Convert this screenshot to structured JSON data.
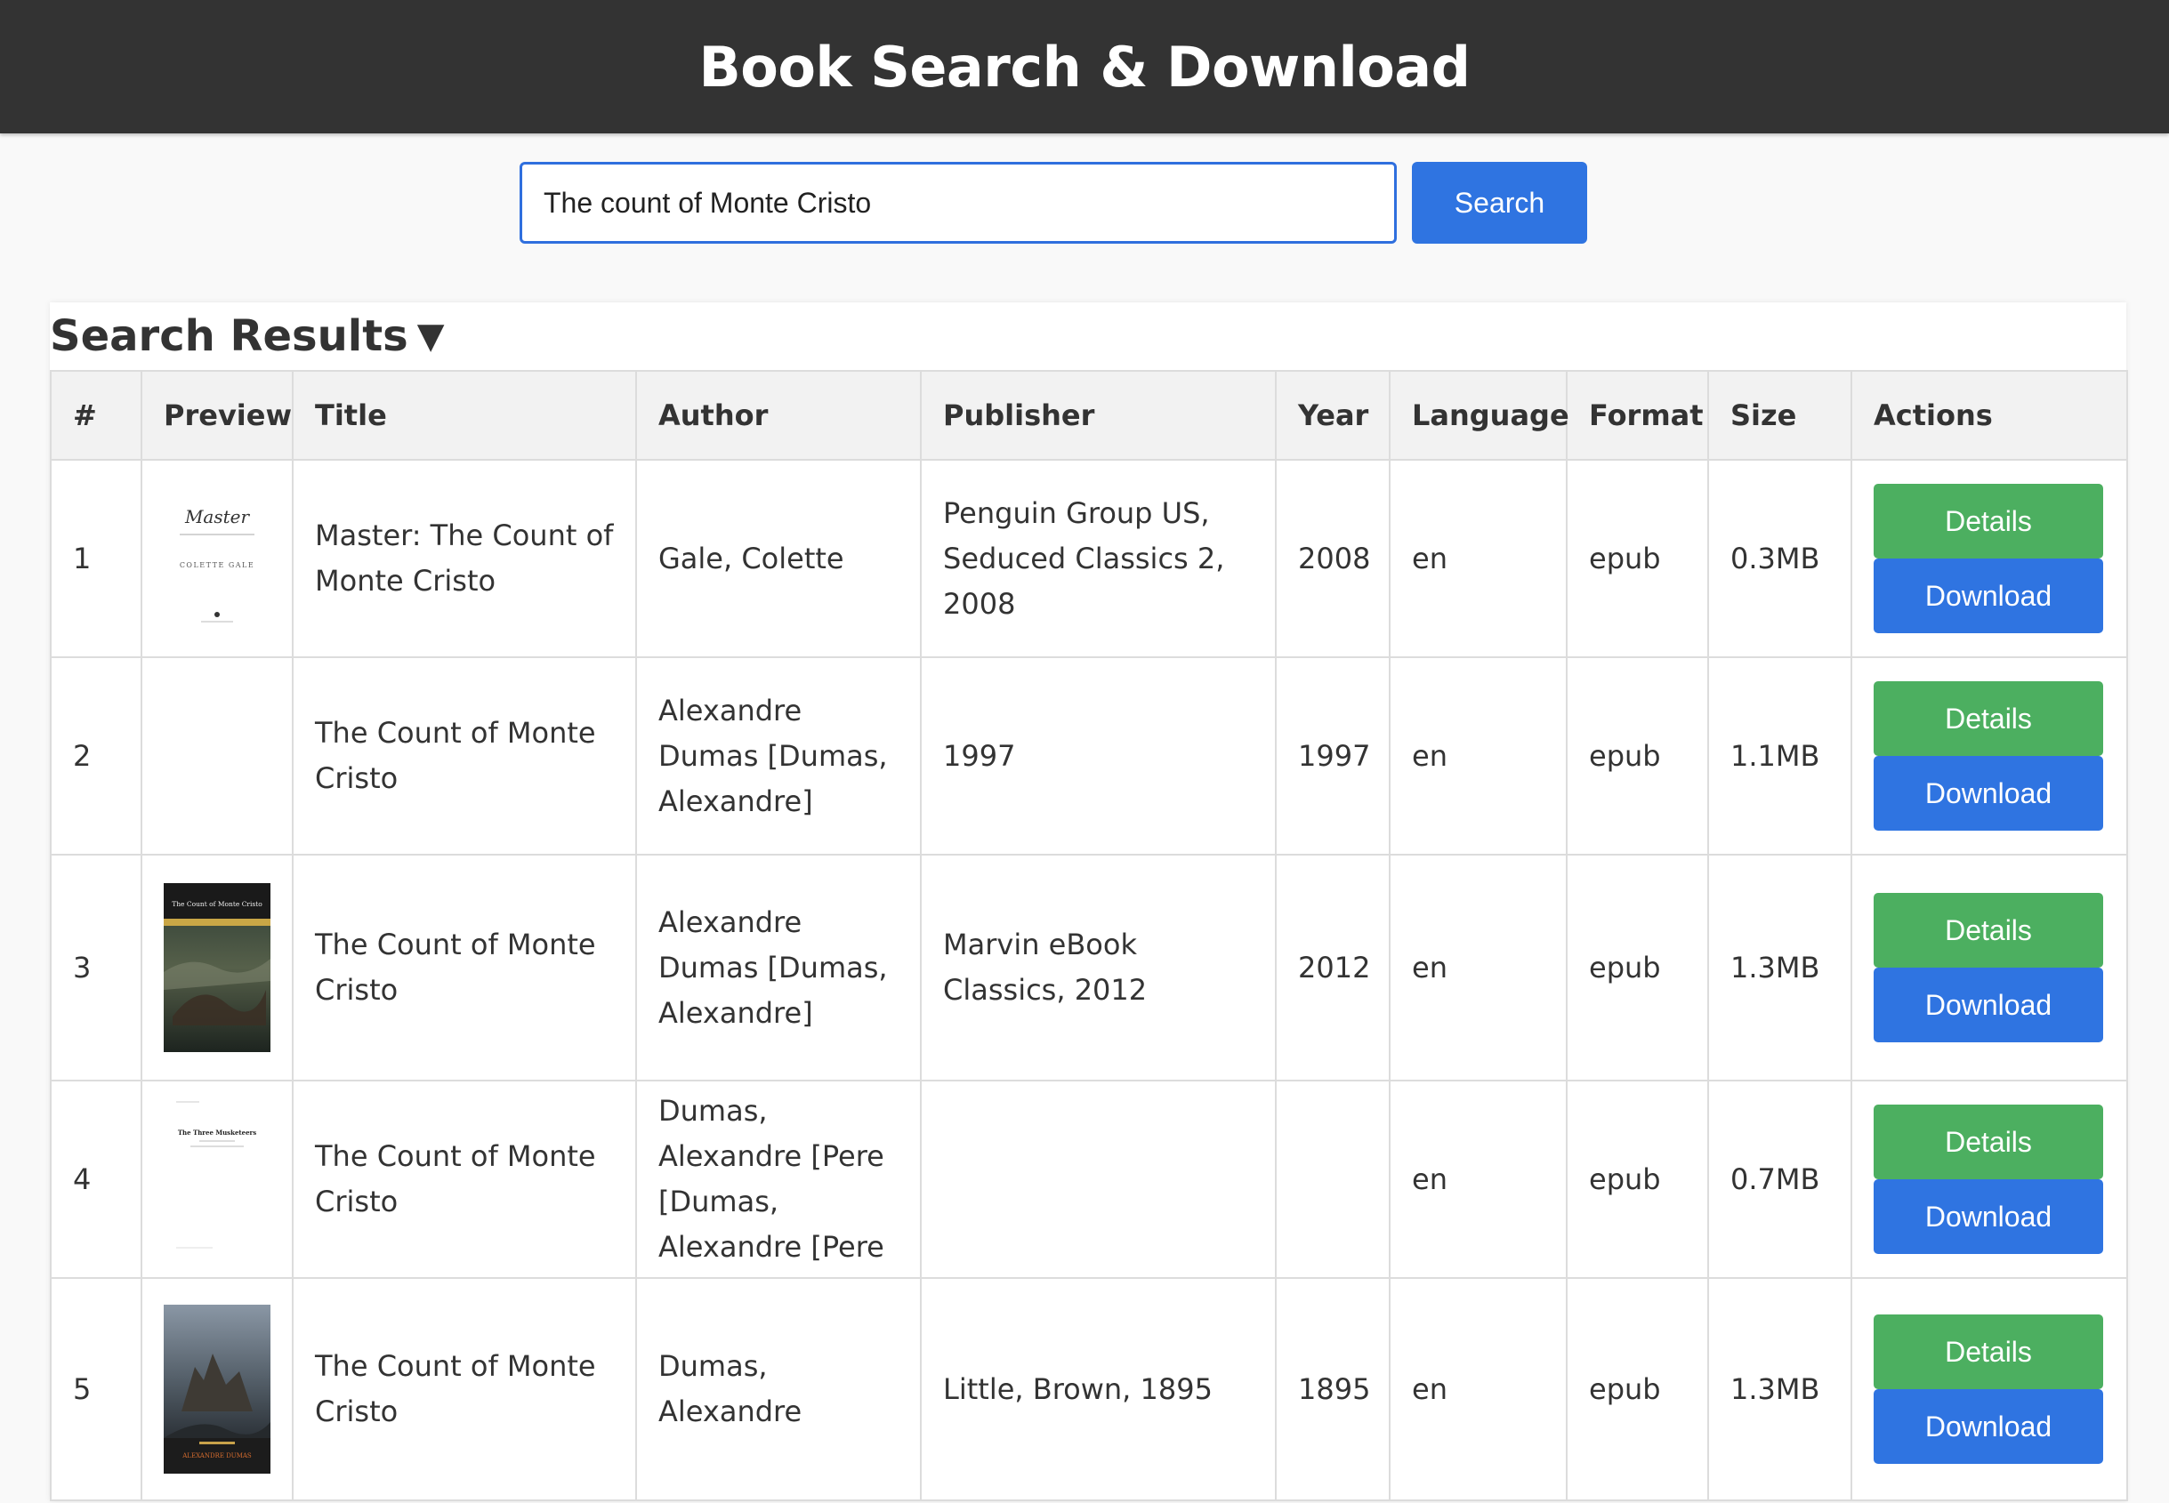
{
  "header": {
    "title": "Book Search & Download"
  },
  "search": {
    "value": "The count of Monte Cristo",
    "button_label": "Search"
  },
  "results": {
    "heading": "Search Results",
    "toggle_icon": "▼",
    "columns": [
      "#",
      "Preview",
      "Title",
      "Author",
      "Publisher",
      "Year",
      "Language",
      "Format",
      "Size",
      "Actions"
    ],
    "details_label": "Details",
    "download_label": "Download",
    "rows": [
      {
        "num": "1",
        "title": "Master: The Count of Monte Cristo",
        "author": "Gale, Colette",
        "publisher": "Penguin Group US, Seduced Classics 2, 2008",
        "year": "2008",
        "language": "en",
        "format": "epub",
        "size": "0.3MB",
        "cover_text": [
          "Master",
          "COLETTE GALE"
        ]
      },
      {
        "num": "2",
        "title": "The Count of Monte Cristo",
        "author": "Alexandre Dumas [Dumas, Alexandre]",
        "publisher": "1997",
        "year": "1997",
        "language": "en",
        "format": "epub",
        "size": "1.1MB"
      },
      {
        "num": "3",
        "title": "The Count of Monte Cristo",
        "author": "Alexandre Dumas [Dumas, Alexandre]",
        "publisher": "Marvin eBook Classics, 2012",
        "year": "2012",
        "language": "en",
        "format": "epub",
        "size": "1.3MB",
        "cover_text": [
          "The Count of Monte Cristo"
        ]
      },
      {
        "num": "4",
        "title": "The Count of Monte Cristo",
        "author": "Dumas, Alexandre [Pere [Dumas, Alexandre [Pere",
        "publisher": "",
        "year": "",
        "language": "en",
        "format": "epub",
        "size": "0.7MB",
        "cover_text": [
          "The Three Musketeers"
        ]
      },
      {
        "num": "5",
        "title": "The Count of Monte Cristo",
        "author": "Dumas, Alexandre",
        "publisher": "Little, Brown, 1895",
        "year": "1895",
        "language": "en",
        "format": "epub",
        "size": "1.3MB",
        "cover_text": [
          "ALEXANDRE DUMAS"
        ]
      }
    ]
  }
}
